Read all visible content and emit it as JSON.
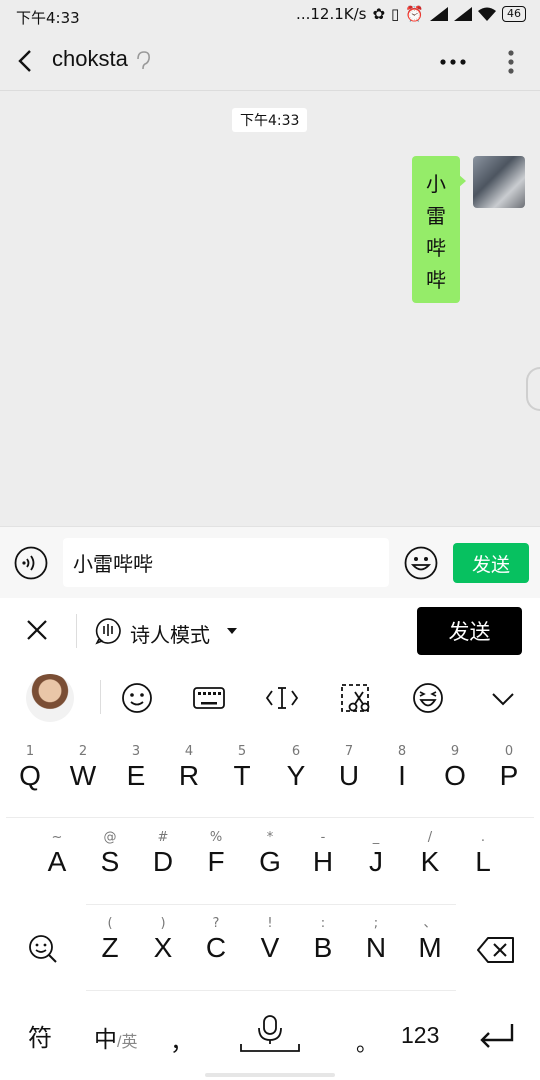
{
  "status_bar": {
    "time": "下午4:33",
    "net_speed": "...12.1K/s",
    "battery": "46"
  },
  "header": {
    "title": "choksta"
  },
  "chat": {
    "timestamp": "下午4:33",
    "messages": [
      {
        "from": "me",
        "chars": [
          "小",
          "雷",
          "哔",
          "哔"
        ]
      }
    ]
  },
  "input_bar": {
    "value": "小雷哔哔",
    "send_label": "发送"
  },
  "ime_bar": {
    "mode_label": "诗人模式",
    "send_label": "发送"
  },
  "toolbar_icons": [
    "avatar",
    "smiley-icon",
    "keyboard-icon",
    "cursor-icon",
    "clipboard-scissors-icon",
    "emoji-icon",
    "collapse-chevron-icon"
  ],
  "keyboard": {
    "row1": [
      {
        "hint": "1",
        "key": "Q"
      },
      {
        "hint": "2",
        "key": "W"
      },
      {
        "hint": "3",
        "key": "E"
      },
      {
        "hint": "4",
        "key": "R"
      },
      {
        "hint": "5",
        "key": "T"
      },
      {
        "hint": "6",
        "key": "Y"
      },
      {
        "hint": "7",
        "key": "U"
      },
      {
        "hint": "8",
        "key": "I"
      },
      {
        "hint": "9",
        "key": "O"
      },
      {
        "hint": "0",
        "key": "P"
      }
    ],
    "row2": [
      {
        "hint": "~",
        "key": "A"
      },
      {
        "hint": "@",
        "key": "S"
      },
      {
        "hint": "#",
        "key": "D"
      },
      {
        "hint": "%",
        "key": "F"
      },
      {
        "hint": "*",
        "key": "G"
      },
      {
        "hint": "-",
        "key": "H"
      },
      {
        "hint": "_",
        "key": "J"
      },
      {
        "hint": "/",
        "key": "K"
      },
      {
        "hint": ".",
        "key": "L"
      }
    ],
    "row3": [
      {
        "hint": "(",
        "key": "Z"
      },
      {
        "hint": ")",
        "key": "X"
      },
      {
        "hint": "?",
        "key": "C"
      },
      {
        "hint": "!",
        "key": "V"
      },
      {
        "hint": ":",
        "key": "B"
      },
      {
        "hint": ";",
        "key": "N"
      },
      {
        "hint": "、",
        "key": "M"
      }
    ],
    "bottom": {
      "symbols": "符",
      "zh": "中",
      "en": "/英",
      "comma": "，",
      "period": "。",
      "numbers": "123"
    }
  }
}
